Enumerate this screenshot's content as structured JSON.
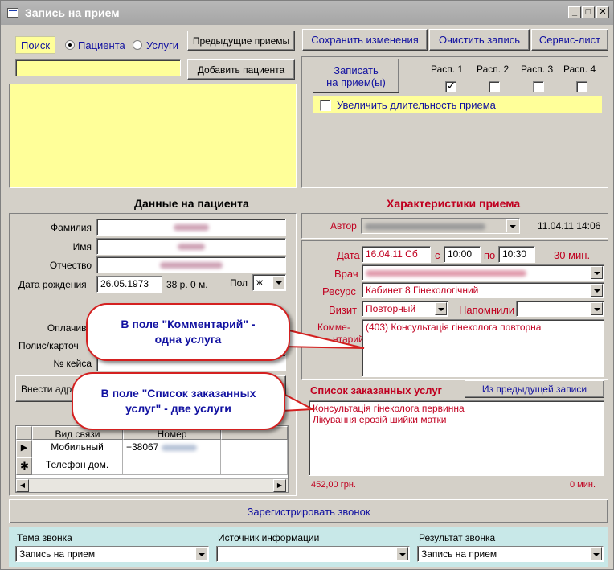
{
  "window": {
    "title": "Запись на прием"
  },
  "search": {
    "label": "Поиск",
    "radio_patients": "Пациента",
    "radio_services": "Услуги",
    "input_value": "",
    "prev_button": "Предыдущие приемы",
    "add_button": "Добавить пациента"
  },
  "toolbar": {
    "save": "Сохранить изменения",
    "clear": "Очистить запись",
    "service": "Сервис-лист"
  },
  "booking": {
    "book_button_line1": "Записать",
    "book_button_line2": "на прием(ы)",
    "schedules": [
      {
        "label": "Расп. 1",
        "checked": true
      },
      {
        "label": "Расп. 2",
        "checked": false
      },
      {
        "label": "Расп. 3",
        "checked": false
      },
      {
        "label": "Расп. 4",
        "checked": false
      }
    ],
    "extend_label": "Увеличить длительность приема"
  },
  "patient": {
    "section_title": "Данные на пациента",
    "surname_label": "Фамилия",
    "name_label": "Имя",
    "patronymic_label": "Отчество",
    "dob_label": "Дата рождения",
    "dob_value": "26.05.1973",
    "age": "38 р. 0 м.",
    "sex_label": "Пол",
    "sex_value": "ж",
    "payer_label": "Оплачива",
    "policy_label": "Полис/карточ",
    "case_label": "№ кейса",
    "address_button": "Внести адре"
  },
  "contacts": {
    "col_type": "Вид связи",
    "col_number": "Номер",
    "rows": [
      {
        "type": "Мобильный",
        "number": "+38067",
        "marker": "▶"
      },
      {
        "type": "Телефон дом.",
        "number": "",
        "marker": "✱"
      }
    ]
  },
  "visit": {
    "section_title": "Характеристики приема",
    "author_label": "Автор",
    "author_stamp": "11.04.11 14:06",
    "date_label": "Дата",
    "date_value": "16.04.11 Сб",
    "from_label": "с",
    "from_value": "10:00",
    "to_label": "по",
    "to_value": "10:30",
    "duration": "30 мин.",
    "doctor_label": "Врач",
    "resource_label": "Ресурс",
    "resource_value": "Кабинет 8 Гінекологічний",
    "visit_label": "Визит",
    "visit_value": "Повторный",
    "remind_label": "Напомнили",
    "comment_label_1": "Комме-",
    "comment_label_2": "нтарий",
    "comment_value": "(403) Консультація гінеколога повторна"
  },
  "services": {
    "title": "Список заказанных услуг",
    "prev_button": "Из предыдущей записи",
    "items": [
      "Консультація гінеколога первинна",
      "Лікування ерозій шийки матки"
    ],
    "total_price": "452,00 грн.",
    "total_time": "0 мин."
  },
  "register_button": "Зарегистрировать звонок",
  "call": {
    "topic_label": "Тема звонка",
    "topic_value": "Запись на прием",
    "source_label": "Источник информации",
    "source_value": "",
    "result_label": "Результат звонка",
    "result_value": "Запись на прием"
  },
  "callouts": {
    "comment_line1": "В поле \"Комментарий\" -",
    "comment_line2": "одна услуга",
    "services_line1": "В поле \"Список заказанных",
    "services_line2": "услуг\" - две услуги"
  }
}
